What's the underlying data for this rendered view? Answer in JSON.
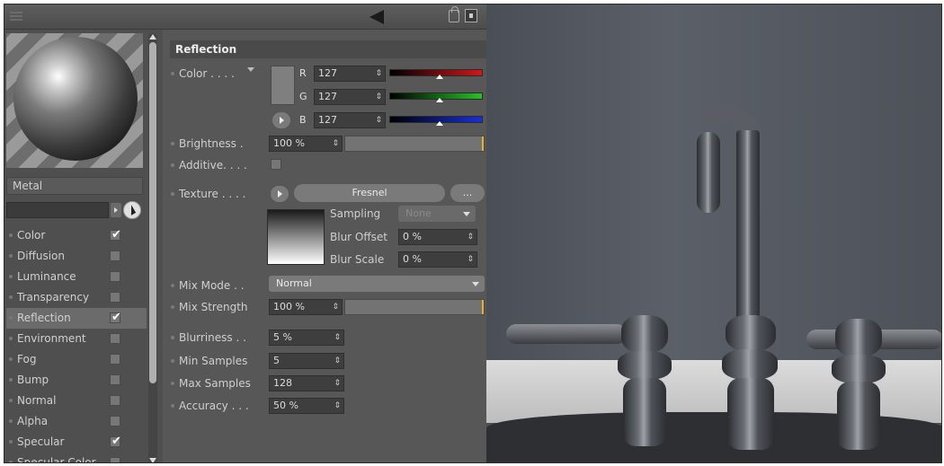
{
  "material": {
    "name": "Metal",
    "channels": [
      {
        "label": "Color",
        "checked": true,
        "selected": false
      },
      {
        "label": "Diffusion",
        "checked": false,
        "selected": false
      },
      {
        "label": "Luminance",
        "checked": false,
        "selected": false
      },
      {
        "label": "Transparency",
        "checked": false,
        "selected": false
      },
      {
        "label": "Reflection",
        "checked": true,
        "selected": true
      },
      {
        "label": "Environment",
        "checked": false,
        "selected": false
      },
      {
        "label": "Fog",
        "checked": false,
        "selected": false
      },
      {
        "label": "Bump",
        "checked": false,
        "selected": false
      },
      {
        "label": "Normal",
        "checked": false,
        "selected": false
      },
      {
        "label": "Alpha",
        "checked": false,
        "selected": false
      },
      {
        "label": "Specular",
        "checked": true,
        "selected": false
      },
      {
        "label": "Specular Color",
        "checked": false,
        "selected": false
      }
    ]
  },
  "reflection": {
    "section_title": "Reflection",
    "color_label": "Color . . . .",
    "r_label": "R",
    "r_value": "127",
    "g_label": "G",
    "g_value": "127",
    "b_label": "B",
    "b_value": "127",
    "brightness_label": "Brightness .",
    "brightness_value": "100 %",
    "additive_label": "Additive. . . .",
    "texture_label": "Texture . . . .",
    "texture_name": "Fresnel",
    "texture_more": "...",
    "sampling_label": "Sampling",
    "sampling_value": "None",
    "blur_offset_label": "Blur Offset",
    "blur_offset_value": "0 %",
    "blur_scale_label": "Blur Scale",
    "blur_scale_value": "0 %",
    "mix_mode_label": "Mix Mode . .",
    "mix_mode_value": "Normal",
    "mix_strength_label": "Mix Strength",
    "mix_strength_value": "100 %",
    "blurriness_label": "Blurriness . .",
    "blurriness_value": "5 %",
    "min_samples_label": "Min Samples",
    "min_samples_value": "5",
    "max_samples_label": "Max Samples",
    "max_samples_value": "128",
    "accuracy_label": "Accuracy . . .",
    "accuracy_value": "50 %"
  },
  "icons": {
    "back": "back-arrow-icon",
    "lock": "lock-icon",
    "pin": "pin-icon",
    "picker": "eyedropper-icon"
  },
  "colors": {
    "panel_bg": "#575757",
    "accent_slider": "#e8b030",
    "red": "#d01818",
    "green": "#28c028",
    "blue": "#1830d8"
  }
}
